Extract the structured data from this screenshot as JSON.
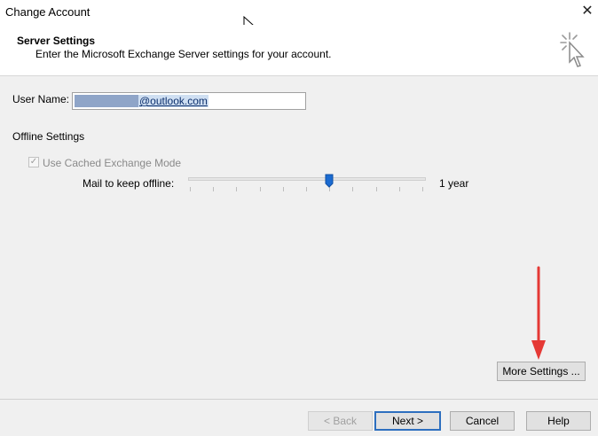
{
  "window": {
    "title": "Change Account",
    "close_glyph": "✕"
  },
  "header": {
    "title": "Server Settings",
    "subtitle": "Enter the Microsoft Exchange Server settings for your account.",
    "icon": "cursor-sparkle-icon"
  },
  "form": {
    "user_name_label": "User Name:",
    "user_name_value": "@outlook.com",
    "offline_heading": "Offline Settings",
    "cached_mode_label": "Use Cached Exchange Mode",
    "cached_mode_checked": true,
    "mail_keep_label": "Mail to keep offline:",
    "mail_keep_value": "1 year",
    "mail_keep_level": 0.6
  },
  "buttons": {
    "more_settings": "More Settings ...",
    "back": "< Back",
    "next": "Next >",
    "cancel": "Cancel",
    "help": "Help"
  },
  "colors": {
    "accent": "#2d6fbf",
    "annotation_arrow": "#e53935"
  }
}
